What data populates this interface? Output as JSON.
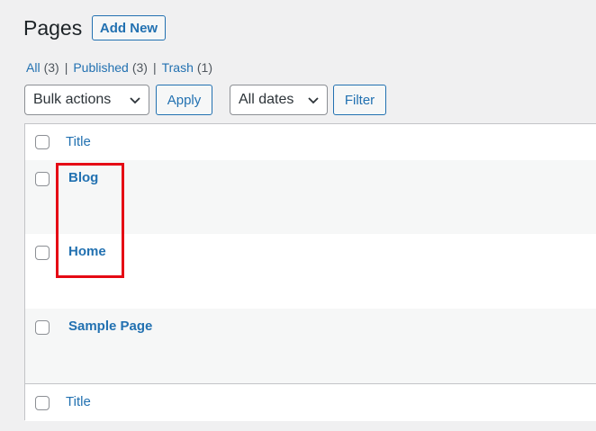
{
  "header": {
    "title": "Pages",
    "add_new_label": "Add New"
  },
  "filters": [
    {
      "label": "All",
      "count": "(3)"
    },
    {
      "label": "Published",
      "count": "(3)"
    },
    {
      "label": "Trash",
      "count": "(1)"
    }
  ],
  "separator": "|",
  "toolbar": {
    "bulk_actions": "Bulk actions",
    "apply_label": "Apply",
    "dates": "All dates",
    "filter_label": "Filter"
  },
  "table": {
    "column_title": "Title",
    "rows": [
      {
        "title": "Blog"
      },
      {
        "title": "Home"
      },
      {
        "title": "Sample Page"
      }
    ]
  },
  "colors": {
    "link": "#2271b1",
    "highlight": "#e50914",
    "background": "#f0f0f1"
  }
}
